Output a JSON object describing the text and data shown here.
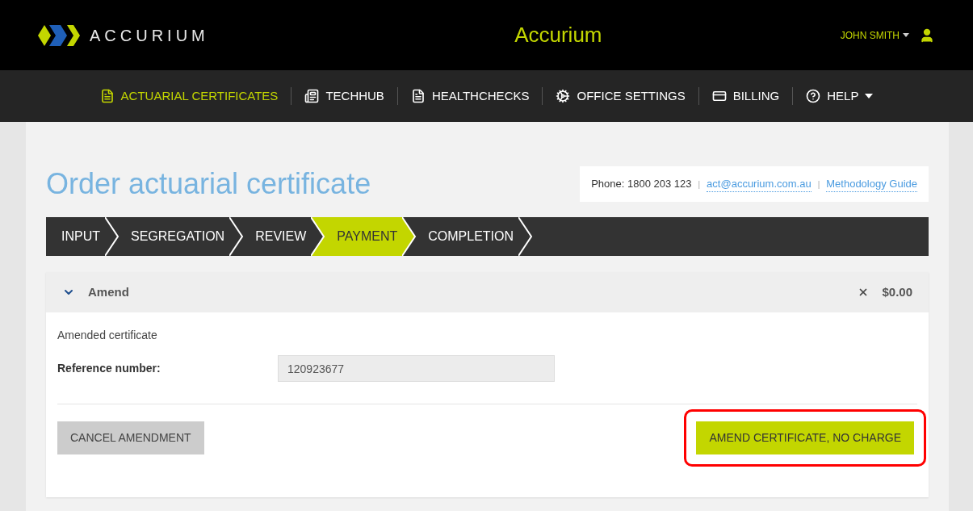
{
  "header": {
    "logo_text": "ACCURIUM",
    "title": "Accurium",
    "user": "JOHN SMITH"
  },
  "nav": [
    {
      "kind": "document",
      "label": "ACTUARIAL CERTIFICATES",
      "selected": true,
      "dropdown": false
    },
    {
      "kind": "news",
      "label": "TECHHUB",
      "selected": false,
      "dropdown": false
    },
    {
      "kind": "document",
      "label": "HEALTHCHECKS",
      "selected": false,
      "dropdown": false
    },
    {
      "kind": "gears",
      "label": "OFFICE SETTINGS",
      "selected": false,
      "dropdown": false
    },
    {
      "kind": "card",
      "label": "BILLING",
      "selected": false,
      "dropdown": false
    },
    {
      "kind": "help",
      "label": "HELP",
      "selected": false,
      "dropdown": true
    }
  ],
  "page_title": "Order actuarial certificate",
  "contact": {
    "phone": "Phone: 1800 203 123",
    "separator": "|",
    "email": "act@accurium.com.au",
    "guide": "Methodology Guide"
  },
  "steps": [
    {
      "label": "INPUT",
      "selected": false
    },
    {
      "label": "SEGREGATION",
      "selected": false
    },
    {
      "label": "REVIEW",
      "selected": false
    },
    {
      "label": "PAYMENT",
      "selected": true
    },
    {
      "label": "COMPLETION",
      "selected": false
    }
  ],
  "section": {
    "title": "Amend",
    "expanded": true,
    "price": "$0.00",
    "subtitle": "Amended certificate",
    "field_label": "Reference number:",
    "field_value": "120923677"
  },
  "buttons": {
    "cancel": "CANCEL AMENDMENT",
    "confirm": "AMEND CERTIFICATE, NO CHARGE",
    "highlighted": true
  }
}
